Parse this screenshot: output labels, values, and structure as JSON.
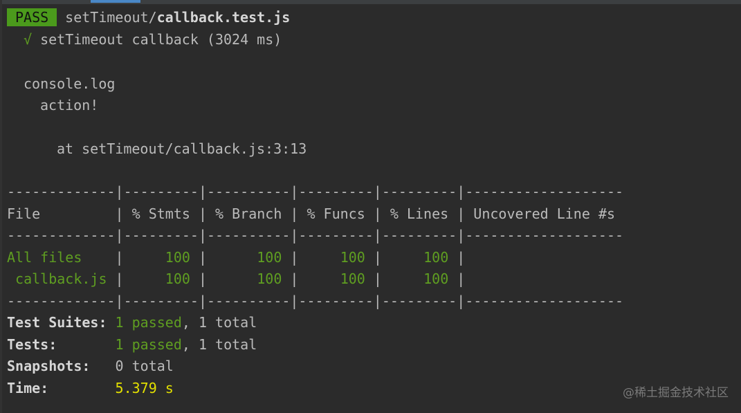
{
  "header": {
    "status_badge": "PASS",
    "file_path_prefix": "setTimeout/",
    "file_name": "callback.test.js"
  },
  "test_result": {
    "check_mark": "√",
    "text": "setTimeout callback (3024 ms)"
  },
  "console": {
    "label": "console.log",
    "message": "action!",
    "location": "at setTimeout/callback.js:3:13"
  },
  "coverage": {
    "separator": "-------------|---------|----------|---------|---------|-------------------",
    "header_row": "File         | % Stmts | % Branch | % Funcs | % Lines | Uncovered Line #s",
    "rows": [
      {
        "name": "All files",
        "stmts": "100",
        "branch": "100",
        "funcs": "100",
        "lines": "100"
      },
      {
        "name": "callback.js",
        "stmts": "100",
        "branch": "100",
        "funcs": "100",
        "lines": "100"
      }
    ]
  },
  "summary": {
    "suites_label": "Test Suites:",
    "suites_passed": "1 passed",
    "suites_total": ", 1 total",
    "tests_label": "Tests:",
    "tests_passed": "1 passed",
    "tests_total": ", 1 total",
    "snapshots_label": "Snapshots:",
    "snapshots_value": "0 total",
    "time_label": "Time:",
    "time_value": "5.379 s"
  },
  "watermark": "@稀土掘金技术社区",
  "colors": {
    "background": "#2b2b2b",
    "pass_badge": "#4b9a1c",
    "green": "#5f9e21",
    "yellow": "#e3e000",
    "text": "#bbbbbb"
  }
}
